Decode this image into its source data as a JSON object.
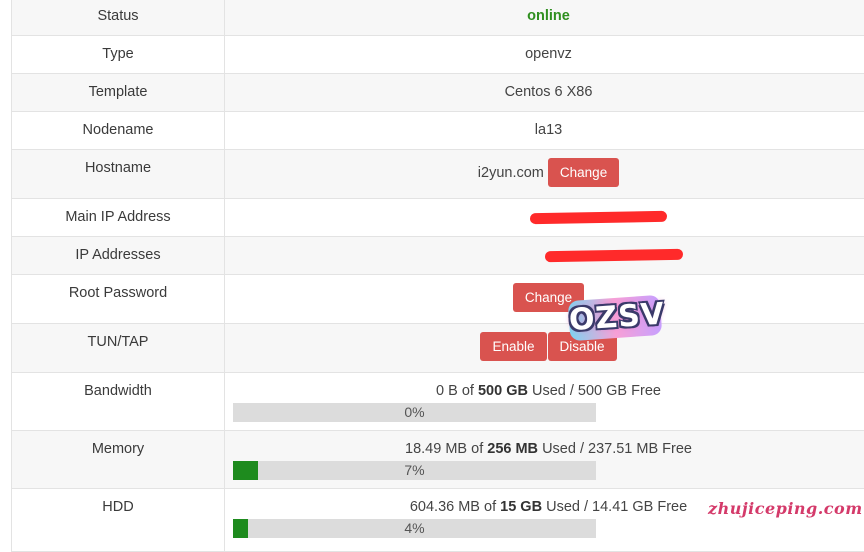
{
  "rows": {
    "status": {
      "label": "Status",
      "value": "online"
    },
    "type": {
      "label": "Type",
      "value": "openvz"
    },
    "template": {
      "label": "Template",
      "value": "Centos 6 X86"
    },
    "nodename": {
      "label": "Nodename",
      "value": "la13"
    },
    "hostname": {
      "label": "Hostname",
      "value": "i2yun.com",
      "button": "Change"
    },
    "main_ip": {
      "label": "Main IP Address"
    },
    "ip_addresses": {
      "label": "IP Addresses"
    },
    "root_password": {
      "label": "Root Password",
      "button": "Change"
    },
    "tun_tap": {
      "label": "TUN/TAP",
      "enable": "Enable",
      "disable": "Disable"
    },
    "bandwidth": {
      "label": "Bandwidth",
      "used": "0 B",
      "of": "of",
      "total": "500 GB",
      "used_word": "Used",
      "free": "/ 500 GB Free",
      "percent": 0,
      "percent_label": "0%"
    },
    "memory": {
      "label": "Memory",
      "used": "18.49 MB",
      "of": "of",
      "total": "256 MB",
      "used_word": "Used",
      "free": "/ 237.51 MB Free",
      "percent": 7,
      "percent_label": "7%"
    },
    "hdd": {
      "label": "HDD",
      "used": "604.36 MB",
      "of": "of",
      "total": "15 GB",
      "used_word": "Used",
      "free": "/ 14.41 GB Free",
      "percent": 4,
      "percent_label": "4%"
    }
  },
  "overlay": {
    "badge": "OZSV",
    "watermark": "zhujiceping.com"
  },
  "colors": {
    "online": "#2f8f1f",
    "button": "#d9534f",
    "bar_fill": "#1e8b1e",
    "bar_bg": "#dcdcdc"
  }
}
